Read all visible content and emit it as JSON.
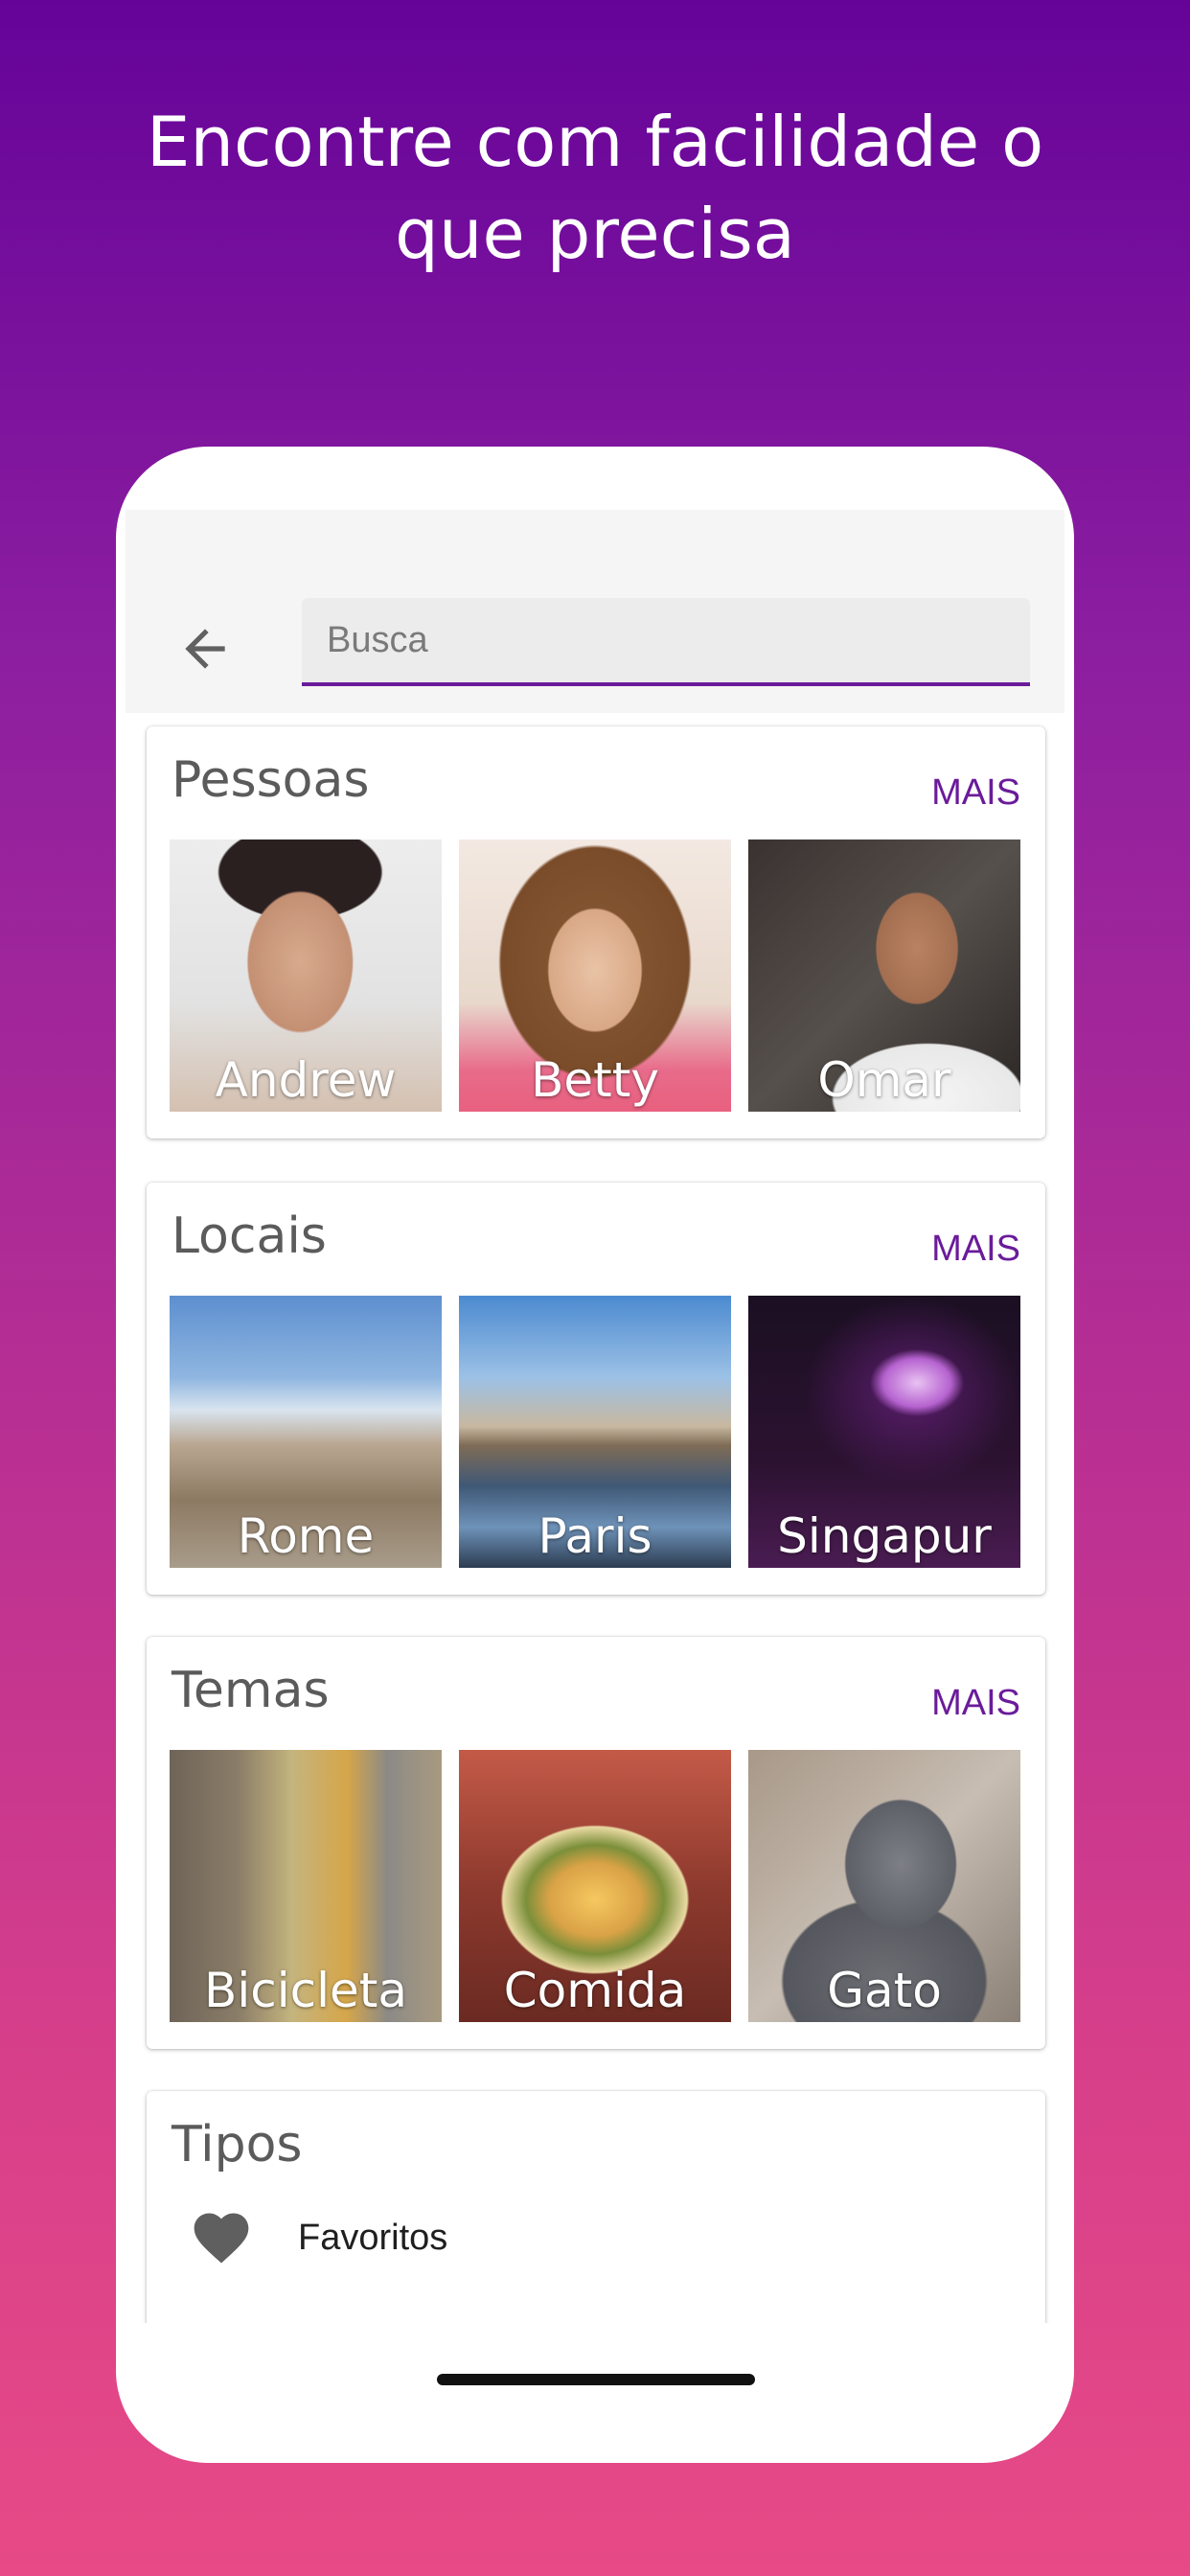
{
  "headline": {
    "line1": "Encontre com facilidade o",
    "line2": "que precisa"
  },
  "search": {
    "placeholder": "Busca",
    "value": ""
  },
  "sections": [
    {
      "title": "Pessoas",
      "more": "MAIS",
      "tiles": [
        "Andrew",
        "Betty",
        "Omar"
      ]
    },
    {
      "title": "Locais",
      "more": "MAIS",
      "tiles": [
        "Rome",
        "Paris",
        "Singapur"
      ]
    },
    {
      "title": "Temas",
      "more": "MAIS",
      "tiles": [
        "Bicicleta",
        "Comida",
        "Gato"
      ]
    }
  ],
  "tipos": {
    "title": "Tipos",
    "items": [
      {
        "label": "Favoritos",
        "icon": "heart-icon"
      }
    ]
  },
  "colors": {
    "accent": "#6a1b9a",
    "gradient_top": "#650399",
    "gradient_bottom": "#e74a86"
  }
}
